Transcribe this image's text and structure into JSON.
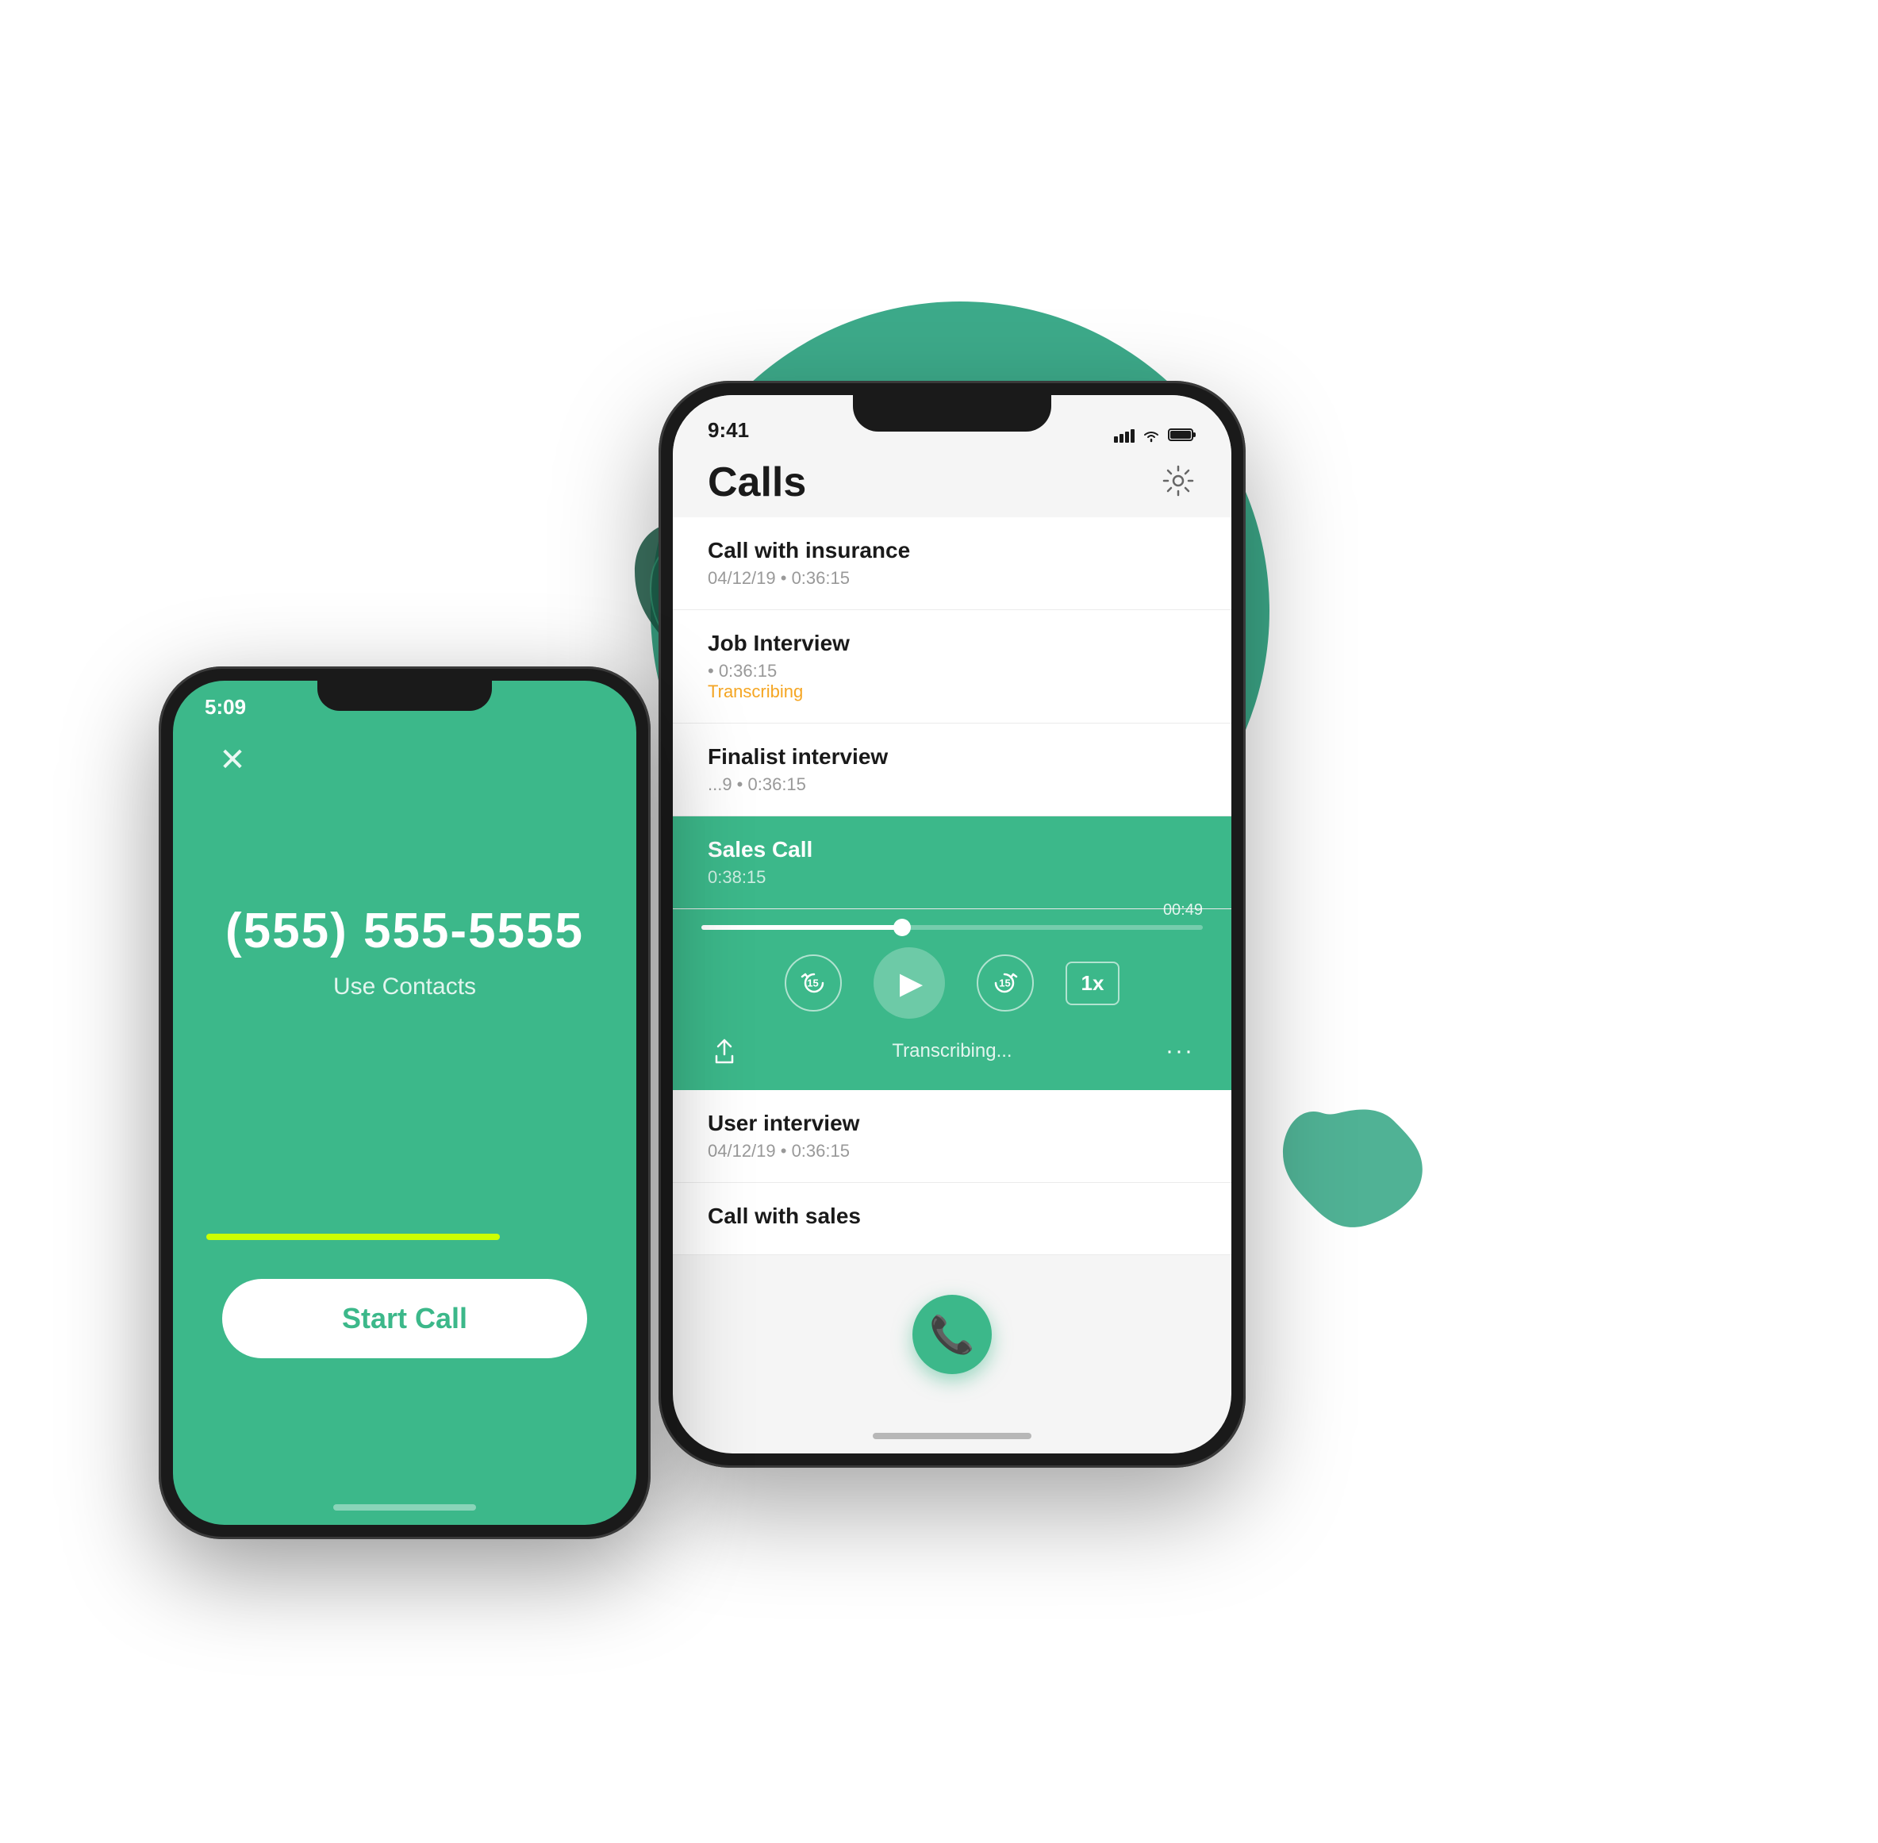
{
  "background": {
    "circle_color": "#3daa8a"
  },
  "accent_line_color": "#ccff00",
  "left_phone": {
    "time": "5:09",
    "phone_number": "(555) 555-5555",
    "contacts_link": "Use Contacts",
    "start_call_label": "Start Call",
    "background_color": "#3cb88a"
  },
  "right_phone": {
    "time": "9:41",
    "page_title": "Calls",
    "settings_icon": "gear-icon",
    "calls": [
      {
        "title": "Call with insurance",
        "date": "04/12/19",
        "duration": "0:36:15",
        "status": null,
        "active": false
      },
      {
        "title": "Job Interview",
        "date": "",
        "duration": "0:36:15",
        "status": "Transcribing",
        "active": false
      },
      {
        "title": "Finalist interview",
        "date": "...9",
        "duration": "0:36:15",
        "status": null,
        "active": false
      },
      {
        "title": "Sales Call",
        "date": "",
        "duration": "0:38:15",
        "status": null,
        "active": true
      }
    ],
    "player": {
      "progress_percent": 40,
      "time_remaining": "00:49",
      "transcribing_label": "Transcribing...",
      "speed_label": "1x",
      "rewind_seconds": "15",
      "forward_seconds": "15"
    },
    "calls_after": [
      {
        "title": "User interview",
        "date": "04/12/19",
        "duration": "0:36:15"
      },
      {
        "title": "Call with sales",
        "date": "",
        "duration": ""
      }
    ],
    "fab_icon": "phone-icon"
  }
}
